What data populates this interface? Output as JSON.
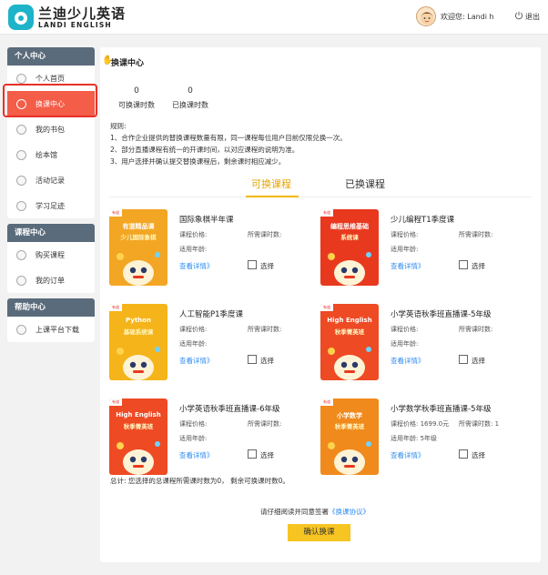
{
  "brand": {
    "name_cn": "兰迪少儿英语",
    "name_en": "LANDI ENGLISH"
  },
  "header": {
    "welcome": "欢迎您:  Landi h",
    "logout": "退出"
  },
  "sidebar": {
    "groups": [
      {
        "title": "个人中心",
        "items": [
          "个人首页",
          "换课中心",
          "我的书包",
          "绘本馆",
          "活动记录",
          "学习足迹"
        ]
      },
      {
        "title": "课程中心",
        "items": [
          "购买课程",
          "我的订单"
        ]
      },
      {
        "title": "帮助中心",
        "items": [
          "上课平台下载"
        ]
      }
    ],
    "active_item": "换课中心"
  },
  "panel": {
    "title": "换课中心",
    "stats": [
      {
        "value": "0",
        "label": "可换课时数"
      },
      {
        "value": "0",
        "label": "已换课时数"
      }
    ],
    "rules": [
      "规则:",
      "1、合作企业提供的替换课程数量有限，同一课程每位用户目前仅限兑换一次。",
      "2、部分直播课程有统一的开课时间，以对应课程的说明为准。",
      "3、用户选择并确认提交替换课程后，剩余课时相应减少。"
    ],
    "tabs": [
      "可换课程",
      "已换课程"
    ],
    "active_tab": "可换课程"
  },
  "courses": [
    {
      "name": "国际象棋半年课",
      "price_label": "课程价格:",
      "price": "",
      "hours_label": "所需课时数:",
      "hours": "",
      "age_label": "适用年龄:",
      "age": "",
      "detail": "查看详情》",
      "select": "选择",
      "cover": {
        "bg": "#f2a623",
        "line1": "有道精品课",
        "line2": "少儿国际象棋"
      }
    },
    {
      "name": "少儿编程T1季度课",
      "price_label": "课程价格:",
      "price": "",
      "hours_label": "所需课时数:",
      "hours": "",
      "age_label": "适用年龄:",
      "age": "",
      "detail": "查看详情》",
      "select": "选择",
      "cover": {
        "bg": "#e8391f",
        "line1": "编程思维基础",
        "line2": "系统课"
      }
    },
    {
      "name": "人工智能P1季度课",
      "price_label": "课程价格:",
      "price": "",
      "hours_label": "所需课时数:",
      "hours": "",
      "age_label": "适用年龄:",
      "age": "",
      "detail": "查看详情》",
      "select": "选择",
      "cover": {
        "bg": "#f4b41a",
        "line1": "Python",
        "line2": "基础系统课"
      }
    },
    {
      "name": "小学英语秋季班直播课-5年级",
      "price_label": "课程价格:",
      "price": "",
      "hours_label": "所需课时数:",
      "hours": "",
      "age_label": "适用年龄:",
      "age": "",
      "detail": "查看详情》",
      "select": "选择",
      "cover": {
        "bg": "#ee4a24",
        "line1": "High English",
        "line2": "秋季菁英班"
      }
    },
    {
      "name": "小学英语秋季班直播课-6年级",
      "price_label": "课程价格:",
      "price": "",
      "hours_label": "所需课时数:",
      "hours": "",
      "age_label": "适用年龄:",
      "age": "",
      "detail": "查看详情》",
      "select": "选择",
      "cover": {
        "bg": "#ee4a24",
        "line1": "High English",
        "line2": "秋季菁英班"
      }
    },
    {
      "name": "小学数学秋季班直播课-5年级",
      "price_label": "课程价格:",
      "price": "1699.0元",
      "hours_label": "所需课时数:",
      "hours": "1",
      "age_label": "适用年龄:",
      "age": "5年级",
      "detail": "查看详情》",
      "select": "选择",
      "cover": {
        "bg": "#f08a1c",
        "line1": "小学数学",
        "line2": "秋季菁英班"
      }
    }
  ],
  "footer": {
    "total": "总计:  您选择的总课程所需课时数为0，  剩余可换课时数0。",
    "agree_prefix": "请仔细阅读并同意签署",
    "agree_link": "《换课协议》",
    "confirm": "确认换课"
  },
  "colors": {
    "accent": "#f2b800",
    "active_sidebar": "#f45d48",
    "sidebar_header": "#5a6b7b",
    "link": "#2d8cf0",
    "highlight_outline": "#e8312a"
  }
}
